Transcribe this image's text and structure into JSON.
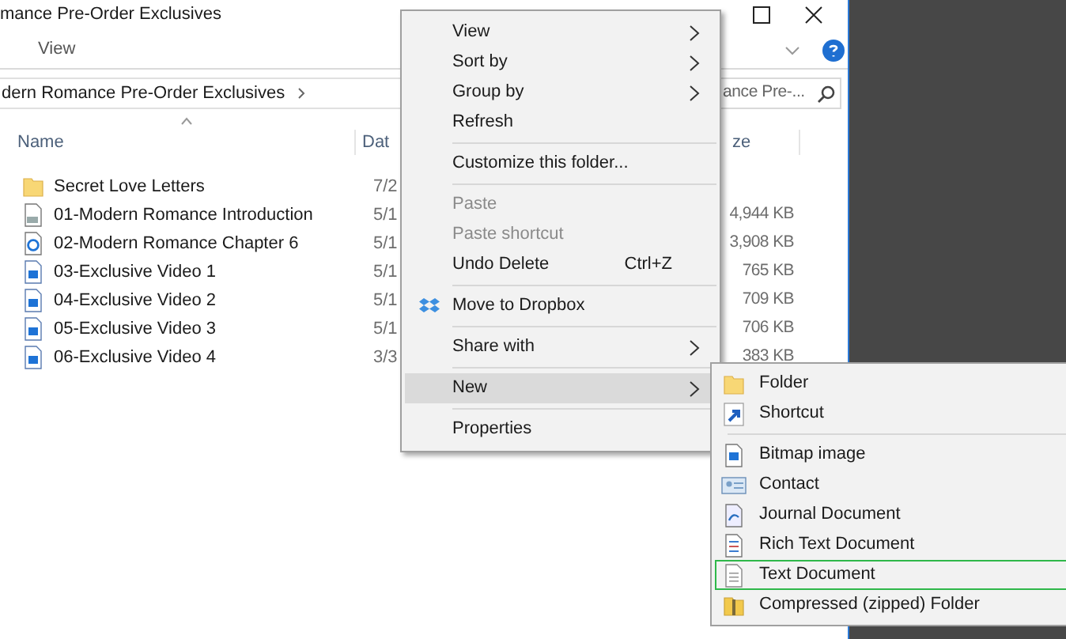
{
  "window": {
    "title": "mance Pre-Order Exclusives"
  },
  "ribbon": {
    "tabs": [
      {
        "label": "View",
        "selected": false
      }
    ]
  },
  "address_bar": {
    "path": "dern Romance Pre-Order Exclusives"
  },
  "search": {
    "placeholder": "ance Pre-..."
  },
  "columns": [
    {
      "label": "Name"
    },
    {
      "label": "Dat"
    },
    {
      "label": "ze"
    }
  ],
  "files": [
    {
      "kind": "folder",
      "name": "Secret Love Letters",
      "date": "7/2"
    },
    {
      "kind": "pdf",
      "name": "01-Modern Romance Introduction",
      "date": "5/1",
      "size": "4,944 KB"
    },
    {
      "kind": "chapter",
      "name": "02-Modern Romance Chapter 6",
      "date": "5/1",
      "size": "3,908 KB"
    },
    {
      "kind": "video",
      "name": "03-Exclusive Video 1",
      "date": "5/1",
      "size": "765 KB"
    },
    {
      "kind": "video",
      "name": "04-Exclusive Video 2",
      "date": "5/1",
      "size": "709 KB"
    },
    {
      "kind": "video",
      "name": "05-Exclusive Video 3",
      "date": "5/1",
      "size": "706 KB"
    },
    {
      "kind": "video",
      "name": "06-Exclusive Video 4",
      "date": "3/3",
      "size": "383 KB"
    }
  ],
  "context_menu": [
    {
      "kind": "item",
      "label": "View",
      "submenu": true,
      "disabled": false,
      "selected": false
    },
    {
      "kind": "item",
      "label": "Sort by",
      "submenu": true,
      "disabled": false,
      "selected": false
    },
    {
      "kind": "item",
      "label": "Group by",
      "submenu": true,
      "disabled": false,
      "selected": false
    },
    {
      "kind": "item",
      "label": "Refresh",
      "submenu": false,
      "disabled": false,
      "selected": false
    },
    {
      "kind": "separator"
    },
    {
      "kind": "item",
      "label": "Customize this folder...",
      "submenu": false,
      "disabled": false,
      "selected": false
    },
    {
      "kind": "separator"
    },
    {
      "kind": "item",
      "label": "Paste",
      "submenu": false,
      "disabled": true,
      "selected": false
    },
    {
      "kind": "item",
      "label": "Paste shortcut",
      "submenu": false,
      "disabled": true,
      "selected": false
    },
    {
      "kind": "item",
      "label": "Undo Delete",
      "shortcut": "Ctrl+Z",
      "submenu": false,
      "disabled": false,
      "selected": false
    },
    {
      "kind": "separator"
    },
    {
      "kind": "dropbox",
      "label": "Move to Dropbox",
      "submenu": false,
      "disabled": false,
      "selected": false
    },
    {
      "kind": "separator"
    },
    {
      "kind": "item",
      "label": "Share with",
      "submenu": true,
      "disabled": false,
      "selected": false
    },
    {
      "kind": "separator"
    },
    {
      "kind": "item",
      "label": "New",
      "submenu": true,
      "disabled": false,
      "selected": true
    },
    {
      "kind": "separator"
    },
    {
      "kind": "item",
      "label": "Properties",
      "submenu": false,
      "disabled": false,
      "selected": false
    }
  ],
  "new_submenu": [
    {
      "kind": "folder",
      "label": "Folder",
      "selected": false
    },
    {
      "kind": "shortcut",
      "label": "Shortcut",
      "selected": false
    },
    {
      "kind": "separator"
    },
    {
      "kind": "bitmap",
      "label": "Bitmap image",
      "selected": false
    },
    {
      "kind": "contact",
      "label": "Contact",
      "selected": false
    },
    {
      "kind": "journal",
      "label": "Journal Document",
      "selected": false
    },
    {
      "kind": "rtf",
      "label": "Rich Text Document",
      "selected": false
    },
    {
      "kind": "text",
      "label": "Text Document",
      "selected": true
    },
    {
      "kind": "zip",
      "label": "Compressed (zipped) Folder",
      "selected": false
    }
  ]
}
